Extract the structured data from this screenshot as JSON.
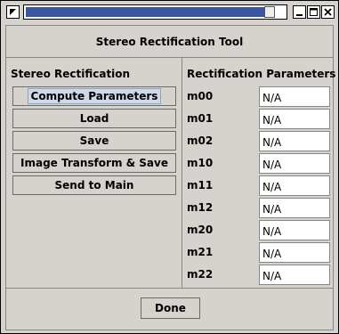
{
  "window": {
    "title": "",
    "colors": {
      "background": "#d6d3ce",
      "titlebar_fill": "#3a56a3",
      "border": "#8a8783"
    },
    "icons": [
      "menu-arrow-icon",
      "minimize-icon",
      "maximize-icon",
      "close-icon"
    ]
  },
  "header": {
    "title": "Stereo Rectification Tool"
  },
  "left": {
    "title": "Stereo Rectification",
    "buttons": [
      "Compute Parameters",
      "Load",
      "Save",
      "Image Transform & Save",
      "Send to Main"
    ]
  },
  "right": {
    "title": "Rectification Parameters",
    "params": [
      {
        "label": "m00",
        "value": "N/A"
      },
      {
        "label": "m01",
        "value": "N/A"
      },
      {
        "label": "m02",
        "value": "N/A"
      },
      {
        "label": "m10",
        "value": "N/A"
      },
      {
        "label": "m11",
        "value": "N/A"
      },
      {
        "label": "m12",
        "value": "N/A"
      },
      {
        "label": "m20",
        "value": "N/A"
      },
      {
        "label": "m21",
        "value": "N/A"
      },
      {
        "label": "m22",
        "value": "N/A"
      }
    ]
  },
  "footer": {
    "done_label": "Done"
  }
}
